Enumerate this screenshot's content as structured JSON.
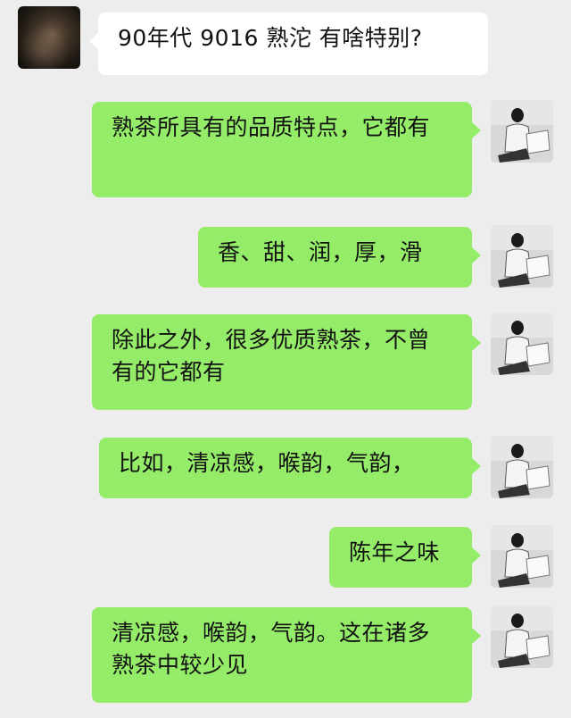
{
  "chat": {
    "incoming": {
      "text": "90年代 9016 熟沱  有啥特别?",
      "avatar_icon": "blurred-contact-avatar"
    },
    "outgoing": [
      {
        "text": "熟茶所具有的品质特点，它都有"
      },
      {
        "text": "香、甜、润，厚，滑"
      },
      {
        "text": "除此之外，很多优质熟茶，不曾有的它都有"
      },
      {
        "text": "比如，清凉感，喉韵，气韵，"
      },
      {
        "text": "陈年之味"
      },
      {
        "text": "清凉感，喉韵，气韵。这在诸多熟茶中较少见"
      }
    ],
    "outgoing_avatar_icon": "man-reading-newspaper-avatar",
    "colors": {
      "background": "#ededed",
      "incoming_bubble": "#ffffff",
      "outgoing_bubble": "#95ec69"
    }
  }
}
